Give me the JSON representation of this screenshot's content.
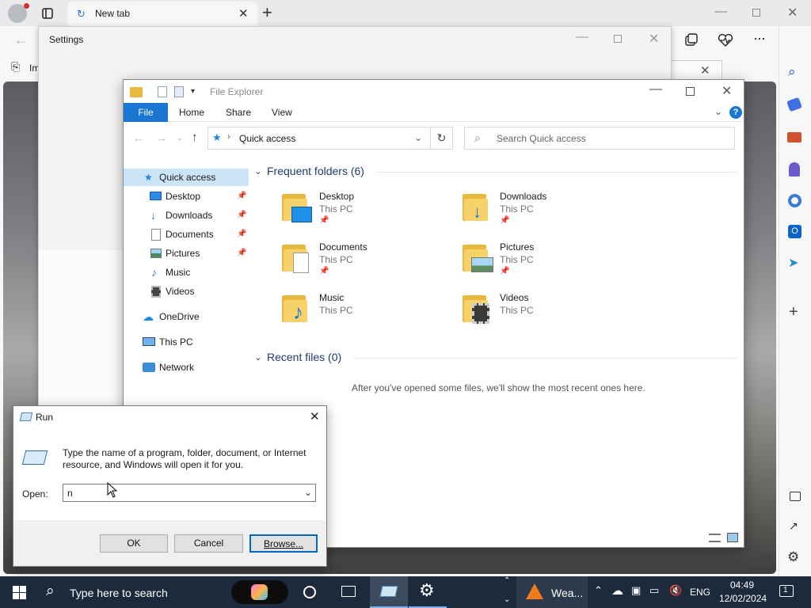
{
  "browser": {
    "tab_title": "New tab",
    "fav_partial": "Im"
  },
  "settings": {
    "title": "Settings"
  },
  "explorer": {
    "title": "File Explorer",
    "ribbon_tabs": [
      "File",
      "Home",
      "Share",
      "View"
    ],
    "address": "Quick access",
    "search_placeholder": "Search Quick access",
    "nav": {
      "quick_access": "Quick access",
      "desktop": "Desktop",
      "downloads": "Downloads",
      "documents": "Documents",
      "pictures": "Pictures",
      "music": "Music",
      "videos": "Videos",
      "onedrive": "OneDrive",
      "thispc": "This PC",
      "network": "Network"
    },
    "frequent_header": "Frequent folders (6)",
    "folders": {
      "desktop": {
        "name": "Desktop",
        "loc": "This PC"
      },
      "downloads": {
        "name": "Downloads",
        "loc": "This PC"
      },
      "documents": {
        "name": "Documents",
        "loc": "This PC"
      },
      "pictures": {
        "name": "Pictures",
        "loc": "This PC"
      },
      "music": {
        "name": "Music",
        "loc": "This PC"
      },
      "videos": {
        "name": "Videos",
        "loc": "This PC"
      }
    },
    "recent_header": "Recent files (0)",
    "recent_empty": "After you've opened some files, we'll show the most recent ones here."
  },
  "run": {
    "title": "Run",
    "description": "Type the name of a program, folder, document, or Internet resource, and Windows will open it for you.",
    "open_label": "Open:",
    "open_value": "n",
    "ok": "OK",
    "cancel": "Cancel",
    "browse": "Browse..."
  },
  "taskbar": {
    "search_placeholder": "Type here to search",
    "weather": "Wea...",
    "language": "ENG",
    "time": "04:49",
    "date": "12/02/2024",
    "notifications": "1"
  },
  "colors": {
    "accent": "#1976d2",
    "taskbar": "#1c2a3b",
    "selection": "#cce4f7"
  }
}
